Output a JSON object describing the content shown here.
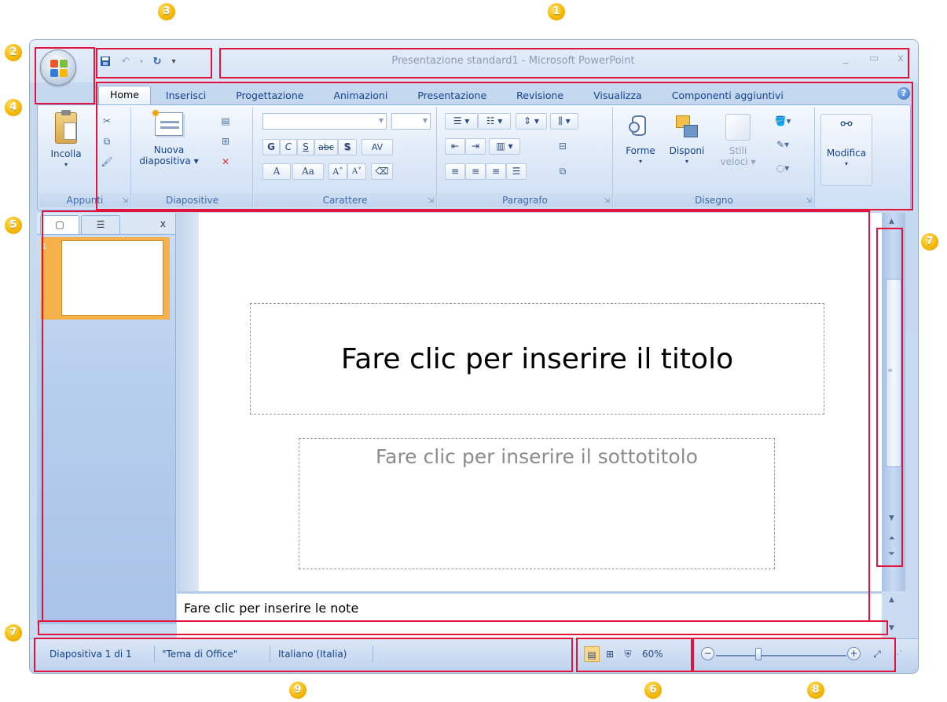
{
  "window": {
    "title": "Presentazione standard1 - Microsoft PowerPoint",
    "controls": [
      "_",
      "▭",
      "x"
    ]
  },
  "quick_access": {
    "customize": "▾"
  },
  "tabs": [
    "Home",
    "Inserisci",
    "Progettazione",
    "Animazioni",
    "Presentazione",
    "Revisione",
    "Visualizza",
    "Componenti aggiuntivi"
  ],
  "help": "?",
  "ribbon": {
    "appunti": {
      "label": "Appunti",
      "paste": "Incolla"
    },
    "diapositive": {
      "label": "Diapositive",
      "new_slide_line1": "Nuova",
      "new_slide_line2": "diapositiva"
    },
    "carattere": {
      "label": "Carattere",
      "bold": "G",
      "italic": "C",
      "underline": "S",
      "strike": "abc",
      "shadow": "S",
      "spacing": "AV",
      "font_color": "A",
      "case": "Aa",
      "grow": "A˄",
      "shrink": "A˅"
    },
    "paragrafo": {
      "label": "Paragrafo"
    },
    "disegno": {
      "label": "Disegno",
      "shapes": "Forme",
      "arrange": "Disponi",
      "styles_line1": "Stili",
      "styles_line2": "veloci"
    },
    "modifica": {
      "label": "Modifica"
    }
  },
  "outline_pane": {
    "close": "x",
    "slide_number": "1"
  },
  "slide": {
    "title_placeholder": "Fare clic per inserire il titolo",
    "subtitle_placeholder": "Fare clic per inserire il sottotitolo"
  },
  "notes": {
    "placeholder": "Fare clic per inserire le note"
  },
  "statusbar": {
    "slide_info": "Diapositiva 1 di 1",
    "theme": "\"Tema di Office\"",
    "language": "Italiano (Italia)",
    "zoom": "60%"
  },
  "callouts": [
    "1",
    "2",
    "3",
    "4",
    "5",
    "6",
    "7",
    "7",
    "8",
    "9"
  ],
  "colors": {
    "annotation": "#e0143c",
    "badge": "#f5b800",
    "ribbon_text": "#15428b"
  }
}
